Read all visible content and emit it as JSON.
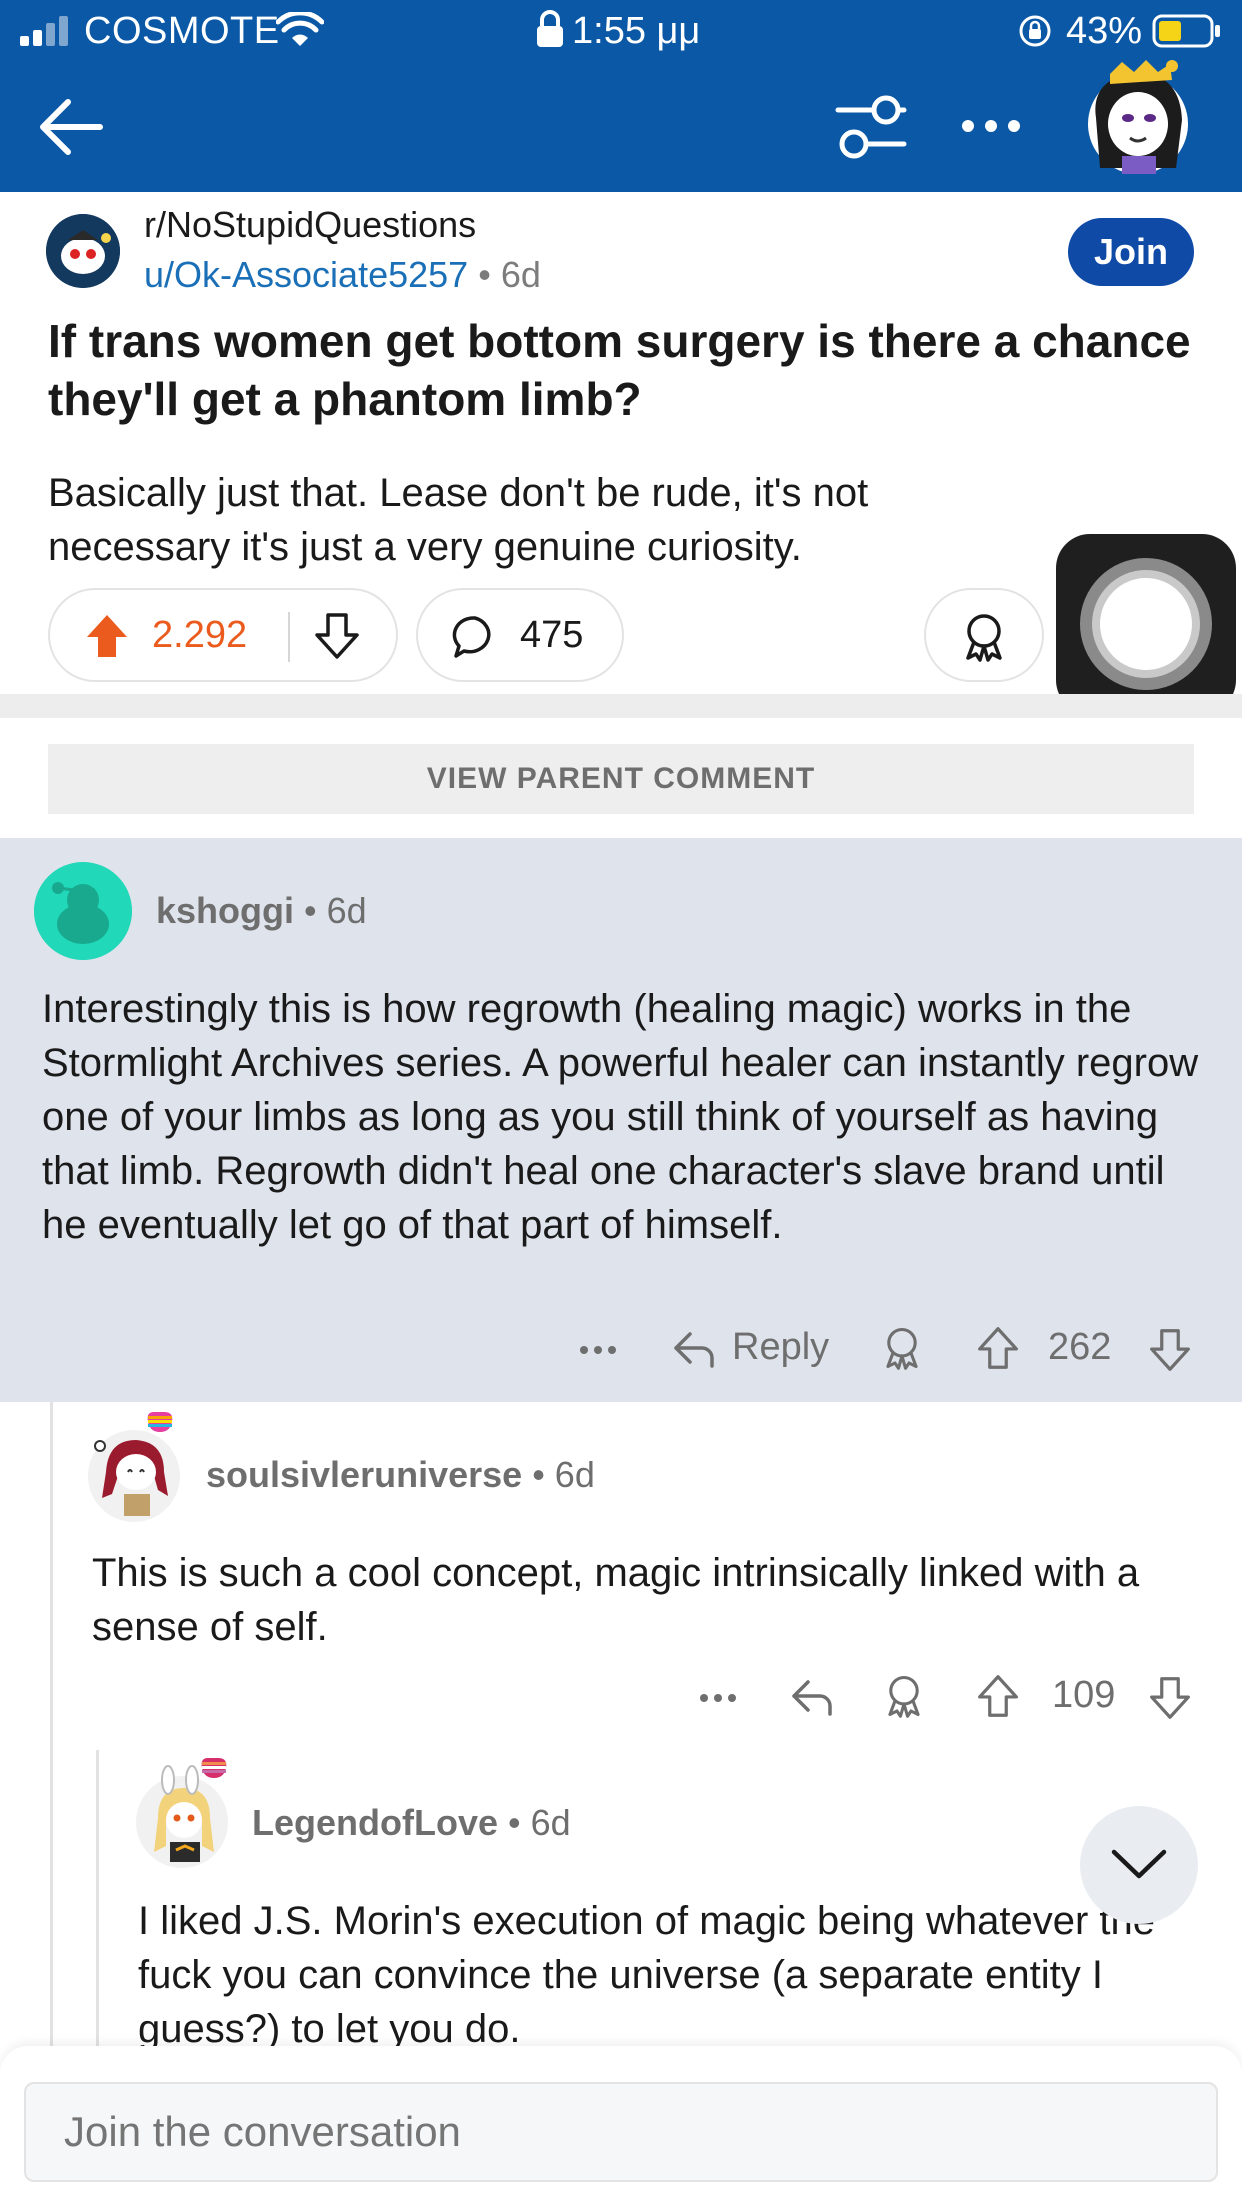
{
  "status_bar": {
    "carrier": "COSMOTE",
    "time": "1:55 μμ",
    "battery": "43%"
  },
  "post": {
    "subreddit": "r/NoStupidQuestions",
    "author": "u/Ok-Associate5257",
    "age": "6d",
    "join_label": "Join",
    "title": "If trans women get bottom surgery is there a chance they'll get a phantom limb?",
    "body": "Basically just that. Lease don't be rude, it's not necessary it's just a very genuine curiosity.",
    "score": "2.292",
    "comments": "475"
  },
  "view_parent_label": "VIEW PARENT COMMENT",
  "comments": [
    {
      "author": "kshoggi",
      "age": "6d",
      "text": "Interestingly this is how regrowth (healing magic) works in the Stormlight Archives series. A powerful healer can instantly regrow one of your limbs as long as you still think of yourself as having that limb. Regrowth didn't heal one character's slave brand until he eventually let go of that part of himself.",
      "reply_label": "Reply",
      "score": "262"
    },
    {
      "author": "soulsivleruniverse",
      "age": "6d",
      "text": "This is such a cool concept, magic intrinsically linked with a sense of self.",
      "score": "109"
    },
    {
      "author": "LegendofLove",
      "age": "6d",
      "text": "I liked J.S. Morin's execution of magic being whatever the fuck you can convince the universe (a separate entity I guess?) to let you do."
    }
  ],
  "composer": {
    "placeholder": "Join the conversation"
  },
  "colors": {
    "header_blue": "#0a58a6",
    "upvote_orange": "#ea5b1d",
    "join_blue": "#0e4aa6",
    "highlight_bg": "#dee3ec",
    "link_blue": "#1a6fb7"
  }
}
